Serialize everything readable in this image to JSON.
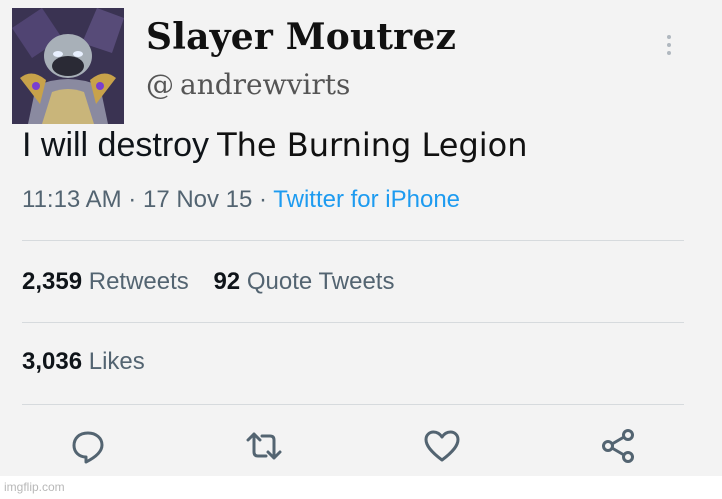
{
  "tweet": {
    "display_name": "Slayer Moutrez",
    "handle_prefix": "@",
    "handle": "andrewvirts",
    "text_original": "I will destroy",
    "text_overlay": "The Burning Legion",
    "time": "11:13 AM",
    "date": "17 Nov 15",
    "separator": "·",
    "source": "Twitter for iPhone",
    "retweets_count": "2,359",
    "retweets_label": "Retweets",
    "quote_count": "92",
    "quote_label": "Quote Tweets",
    "likes_count": "3,036",
    "likes_label": "Likes"
  },
  "icons": {
    "more": "more-vertical-icon",
    "reply": "reply-icon",
    "retweet": "retweet-icon",
    "like": "heart-icon",
    "share": "share-icon"
  },
  "watermark": "imgflip.com",
  "colors": {
    "text": "#0f1419",
    "muted": "#536471",
    "link": "#1d9bf0",
    "background": "#f3f3f3"
  }
}
